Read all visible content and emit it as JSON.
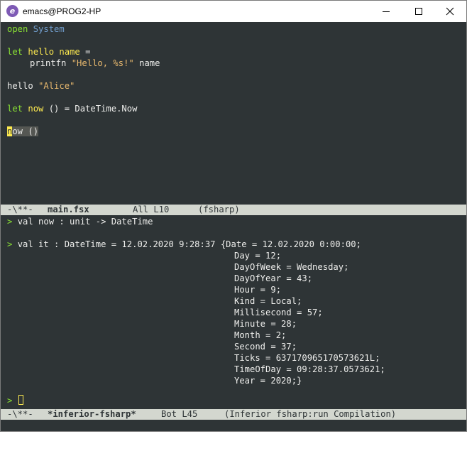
{
  "window": {
    "title": "emacs@PROG2-HP",
    "app_icon_glyph": "e"
  },
  "editor": {
    "line1": {
      "kw": "open",
      "type": "System"
    },
    "line3": {
      "kw": "let",
      "name": "hello name",
      "rest": " ="
    },
    "line4": {
      "fn": "printfn",
      "str": "\"Hello, %s!\"",
      "rest": " name"
    },
    "line6": {
      "text": "hello ",
      "str": "\"Alice\""
    },
    "line8": {
      "kw": "let",
      "name": "now",
      "rest": " () = DateTime.Now"
    },
    "line10": {
      "cursor_char": "n",
      "rest": "ow ()"
    }
  },
  "modeline_top": {
    "status": "-\\**-",
    "buffer": "main.fsx",
    "pos": "All L10",
    "mode": "(fsharp)"
  },
  "repl": {
    "line1": {
      "prompt": ">",
      "text": "val now : unit -> DateTime"
    },
    "line3": {
      "prompt": ">",
      "text": "val it : DateTime = 12.02.2020 9:28:37 {Date = 12.02.2020 0:00:00;"
    },
    "fields": [
      "Day = 12;",
      "DayOfWeek = Wednesday;",
      "DayOfYear = 43;",
      "Hour = 9;",
      "Kind = Local;",
      "Millisecond = 57;",
      "Minute = 28;",
      "Month = 2;",
      "Second = 37;",
      "Ticks = 637170965170573621L;",
      "TimeOfDay = 09:28:37.0573621;",
      "Year = 2020;}"
    ],
    "prompt_final": ">"
  },
  "modeline_bottom": {
    "status": "-\\**-",
    "buffer": "*inferior-fsharp*",
    "pos": "Bot L45",
    "mode": "(Inferior fsharp:run Compilation)"
  },
  "colors": {
    "background": "#2e3436",
    "keyword": "#8ae234",
    "type": "#729fcf",
    "function": "#fce94f",
    "string": "#e9b96e",
    "modeline": "#d3d7cf"
  }
}
